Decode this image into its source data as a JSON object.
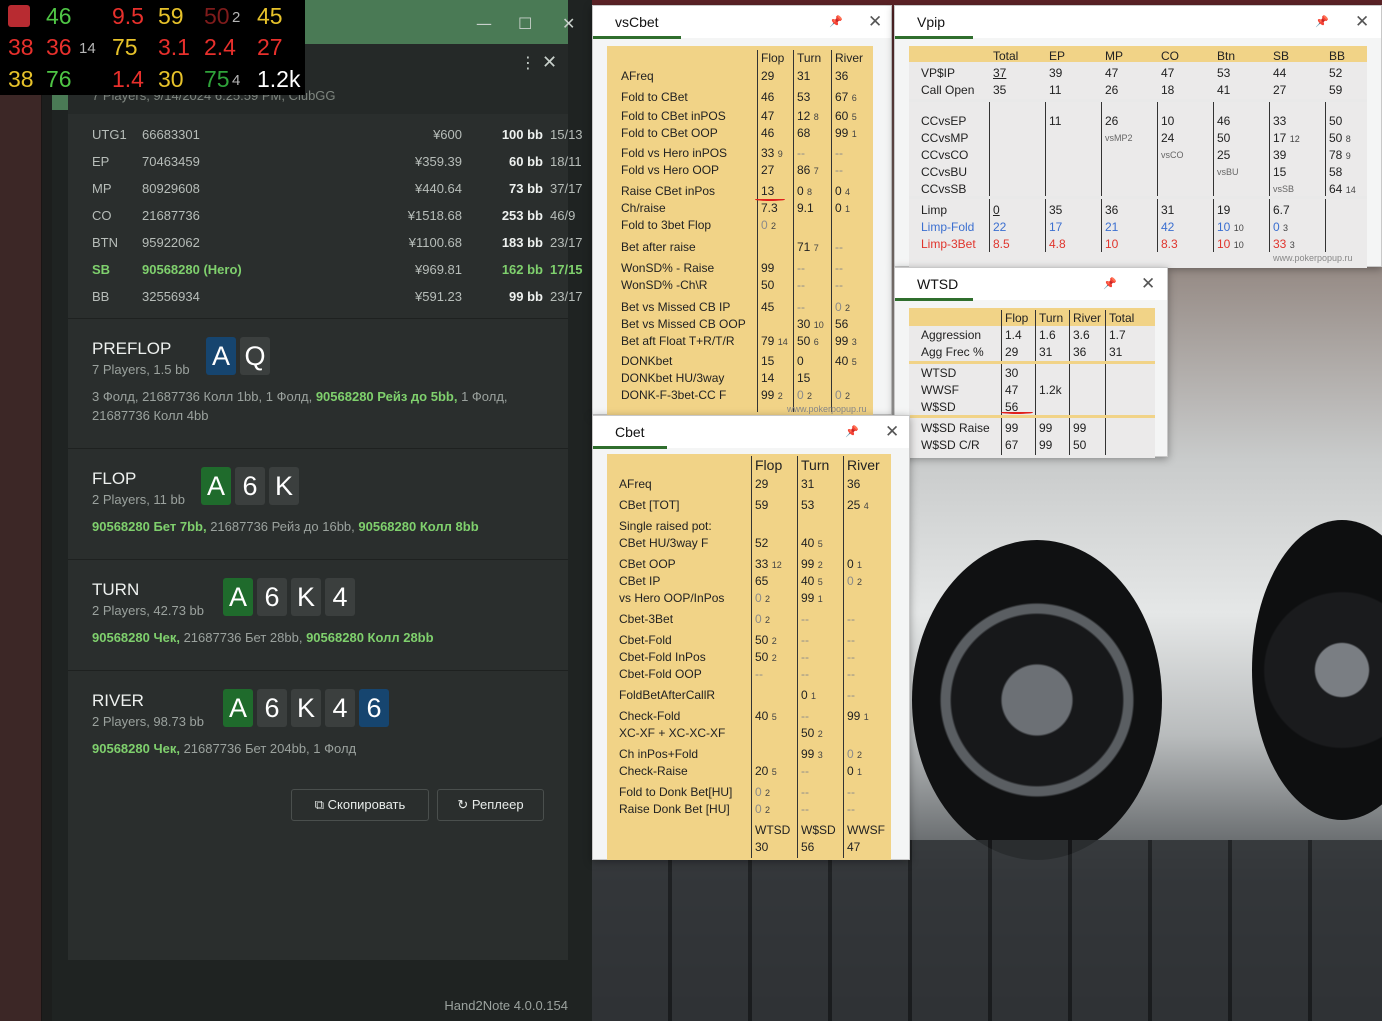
{
  "hud": {
    "row1": [
      "46",
      "9.5",
      "59",
      "50",
      "2",
      "45"
    ],
    "row2": [
      "38",
      "36",
      "14",
      "75",
      "3.1",
      "2.4",
      "27"
    ],
    "row3": [
      "38",
      "76",
      "1.4",
      "30",
      "75",
      "4",
      "1.2k"
    ]
  },
  "hand2note": {
    "meta": "7 Players, 9/14/2024 6:25:59 PM, ClubGG",
    "players": [
      {
        "pos": "UTG1",
        "id": "66683301",
        "money": "¥600",
        "bb": "100 bb",
        "ratio": "15/13"
      },
      {
        "pos": "EP",
        "id": "70463459",
        "money": "¥359.39",
        "bb": "60 bb",
        "ratio": "18/11"
      },
      {
        "pos": "MP",
        "id": "80929608",
        "money": "¥440.64",
        "bb": "73 bb",
        "ratio": "37/17"
      },
      {
        "pos": "CO",
        "id": "21687736",
        "money": "¥1518.68",
        "bb": "253 bb",
        "ratio": "46/9"
      },
      {
        "pos": "BTN",
        "id": "95922062",
        "money": "¥1100.68",
        "bb": "183 bb",
        "ratio": "23/17"
      },
      {
        "pos": "SB",
        "id": "90568280 (Hero)",
        "money": "¥969.81",
        "bb": "162 bb",
        "ratio": "17/15"
      },
      {
        "pos": "BB",
        "id": "32556934",
        "money": "¥591.23",
        "bb": "99 bb",
        "ratio": "23/17"
      }
    ],
    "preflop": {
      "name": "PREFLOP",
      "sub": "7 Players, 1.5 bb",
      "cards": [
        "A",
        "Q"
      ],
      "a1": "3 Фолд, 21687736 Колл 1bb, 1 Фолд,",
      "a2": "90568280 Рейз до 5bb,",
      "a3": "1 Фолд,",
      "a4": "21687736 Колл 4bb"
    },
    "flop": {
      "name": "FLOP",
      "sub": "2 Players, 11 bb",
      "cards": [
        "A",
        "6",
        "K"
      ],
      "a1": "90568280 Бет 7bb,",
      "a2": "21687736 Рейз до 16bb,",
      "a3": "90568280 Колл 8bb"
    },
    "turn": {
      "name": "TURN",
      "sub": "2 Players, 42.73 bb",
      "cards": [
        "A",
        "6",
        "K",
        "4"
      ],
      "a1": "90568280 Чек,",
      "a2": "21687736 Бет 28bb,",
      "a3": "90568280 Колл 28bb"
    },
    "river": {
      "name": "RIVER",
      "sub": "2 Players, 98.73 bb",
      "cards": [
        "A",
        "6",
        "K",
        "4",
        "6"
      ],
      "a1": "90568280 Чек,",
      "a2": "21687736 Бет 204bb, 1 Фолд"
    },
    "copy": "Скопировать",
    "replayer": "Реплеер",
    "version": "Hand2Note 4.0.0.154"
  },
  "vscbet": {
    "title": "vsCbet",
    "rows": [
      "|Flop|Turn|River",
      "AFreq|29|31|36",
      "Fold to CBet|46|53|67 6",
      "Fold to CBet inPOS|47|12 8|60 5",
      "Fold to CBet OOP|46|68|99 1",
      "Fold vs Hero inPOS|33 9|--|--",
      "Fold vs Hero OOP|27|86 7|--",
      "Raise CBet inPos|13|0 8|0 4",
      "Ch/raise|7.3|9.1|0 1",
      "Fold to 3bet Flop|0 2||",
      "Bet after raise||71 7|--",
      "WonSD% - Raise|99|--|--",
      "WonSD% -Ch\\R|50|--|--",
      "Bet vs Missed CB IP|45|--|0 2",
      "Bet vs Missed CB OOP||30 10|56",
      "Bet aft Float T+R/T/R|79 14|50 6|99 3",
      "DONKbet|15|0|40 5",
      "DONKbet HU/3way|14|15|",
      "DONK-F-3bet-CC F|99 2|0 2|0 2"
    ],
    "wm": "www.pokerpopup.ru"
  },
  "vpip": {
    "title": "Vpip",
    "rows": [
      "|Total|EP|MP|CO|Btn|SB|BB",
      "VP$IP|37|39|47|47|53|44|52",
      "Call Open|35|11|26|18|41|27|59",
      "CCvsEP||11|26|10|46|33|50",
      "CCvsMP|||vsMP2|24|50|17 12|50 8",
      "CCvsCO||||vsCO|25|39|78 9",
      "CCvsBU|||||vsBU|15|58",
      "CCvsSB||||||vsSB|64 14",
      "Limp|0|35|36|31|19|6.7|",
      "Limp-Fold|22|17|21|42|10 10|0 3|",
      "Limp-3Bet|8.5|4.8|10|8.3|10 10|33 3|"
    ],
    "wm": "www.pokerpopup.ru"
  },
  "wtsd": {
    "title": "WTSD",
    "rows": [
      "|Flop|Turn|River|Total",
      "Aggression|1.4|1.6|3.6|1.7",
      "Agg Frec %|29|31|36|31",
      "WTSD|30",
      "WWSF|47|1.2k",
      "W$SD|56",
      "W$SD Raise|99|99|99",
      "W$SD C/R|67|99|50"
    ]
  },
  "cbet": {
    "title": "Cbet",
    "rows": [
      "|Flop|Turn|River",
      "AFreq|29|31|36",
      "CBet [TOT]|59|53|25 4",
      "Single raised pot:|||",
      "CBet HU/3way F|52|40 5|",
      "CBet OOP|33 12|99 2|0 1",
      "CBet IP|65|40 5|0 2",
      "vs Hero OOP/InPos|0 2|99 1|",
      "Cbet-3Bet|0 2|--|--",
      "Cbet-Fold|50 2|--|--",
      "Cbet-Fold InPos|50 2|--|--",
      "Cbet-Fold OOP|--|--|--",
      "FoldBetAfterCallR||0 1|--",
      "Check-Fold|40 5|--|99 1",
      "XC-XF + XC-XC-XF||50 2|",
      "Ch inPos+Fold||99 3|0 2",
      "Check-Raise|20 5|--|0 1",
      "Fold to Donk Bet[HU]|0 2|--|--",
      "Raise Donk Bet [HU]|0 2|--|--",
      "|WTSD|W$SD|WWSF",
      "|30|56|47"
    ]
  }
}
